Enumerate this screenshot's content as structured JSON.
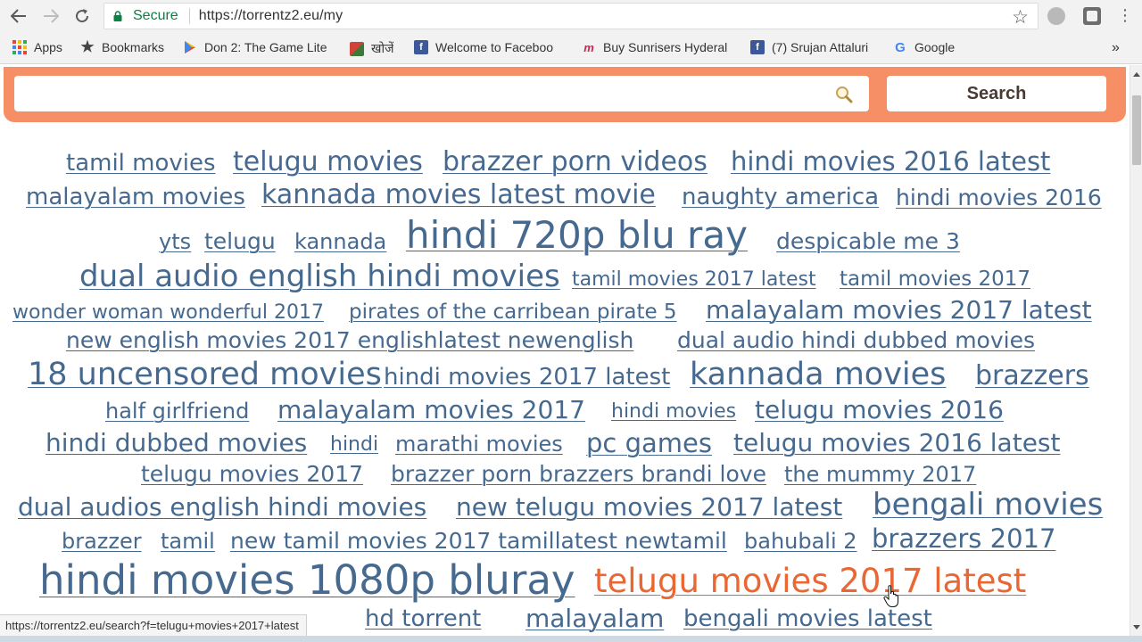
{
  "browser": {
    "secure_label": "Secure",
    "url": "https://torrentz2.eu/my",
    "status_url": "https://torrentz2.eu/search?f=telugu+movies+2017+latest"
  },
  "bookmarks": [
    {
      "label": "Apps",
      "icon": "apps-grid-icon"
    },
    {
      "label": "Bookmarks",
      "icon": "star-icon"
    },
    {
      "label": "Don 2: The Game Lite",
      "icon": "play-store-icon"
    },
    {
      "label": "खोजें",
      "icon": "khoje-icon"
    },
    {
      "label": "Welcome to Faceboo",
      "icon": "facebook-icon"
    },
    {
      "label": "Buy Sunrisers Hyderal",
      "icon": "myntra-icon"
    },
    {
      "label": "(7) Srujan Attaluri",
      "icon": "facebook-icon"
    },
    {
      "label": "Google",
      "icon": "google-icon"
    }
  ],
  "search": {
    "placeholder": "",
    "button_label": "Search"
  },
  "colors": {
    "link": "#46698f",
    "hover": "#ea6733",
    "search_bar": "#f68f66"
  },
  "tags": [
    "tamil movies",
    "telugu movies",
    "brazzer porn videos",
    "hindi movies 2016 latest",
    "malayalam movies",
    "kannada movies latest movie",
    "naughty america",
    "hindi movies 2016",
    "yts",
    "telugu",
    "kannada",
    "hindi 720p blu ray",
    "despicable me 3",
    "dual audio english hindi movies",
    "tamil movies 2017 latest",
    "tamil movies 2017",
    "wonder woman wonderful 2017",
    "pirates of the carribean pirate 5",
    "malayalam movies 2017 latest",
    "new english movies 2017 englishlatest newenglish",
    "dual audio hindi dubbed movies",
    "18 uncensored movies",
    "hindi movies 2017 latest",
    "kannada movies",
    "brazzers",
    "half girlfriend",
    "malayalam movies 2017",
    "hindi movies",
    "telugu movies 2016",
    "hindi dubbed movies",
    "hindi",
    "marathi movies",
    "pc games",
    "telugu movies 2016 latest",
    "telugu movies 2017",
    "brazzer porn brazzers brandi love",
    "the mummy 2017",
    "dual audios english hindi movies",
    "new telugu movies 2017 latest",
    "bengali movies",
    "brazzer",
    "tamil",
    "new tamil movies 2017 tamillatest newtamil",
    "bahubali 2",
    "brazzers 2017",
    "hindi movies 1080p bluray",
    "telugu movies 2017 latest",
    "hd torrent",
    "malayalam",
    "bengali movies latest"
  ]
}
